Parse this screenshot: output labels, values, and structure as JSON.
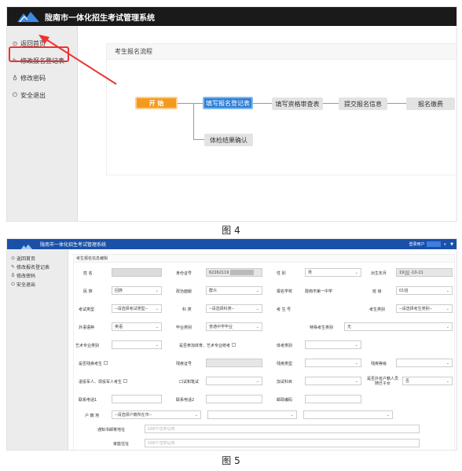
{
  "app": {
    "title": "陇南市一体化招生考试管理系统"
  },
  "fig4": {
    "sidebar": [
      {
        "icon": "⊙",
        "label": "返回首页"
      },
      {
        "icon": "✎",
        "label": "修改报名登记表"
      },
      {
        "icon": "♁",
        "label": "修改密码"
      },
      {
        "icon": "⏻",
        "label": "安全退出"
      }
    ],
    "panel_title": "考生报名流程",
    "flow": {
      "start": "开 始",
      "step1": "填写报名登记表",
      "step2": "填写资格审查表",
      "step3": "提交报名信息",
      "step4": "报名缴费",
      "step5": "体检结果确认"
    },
    "caption": "图 4"
  },
  "fig5": {
    "user_label": "登录用户",
    "user_caret": "∨",
    "sidebar": [
      {
        "icon": "⊙",
        "label": "返回首页"
      },
      {
        "icon": "✎",
        "label": "修改报名登记表"
      },
      {
        "icon": "♁",
        "label": "修改密码"
      },
      {
        "icon": "⏻",
        "label": "安全退出"
      }
    ],
    "form_title": "考生报名信息编辑",
    "labels": {
      "name": "姓 名",
      "id_no": "身份证号",
      "gender": "性 别",
      "birth": "出生年月",
      "ethnic": "民 族",
      "politics": "政治面貌",
      "school": "报名学校",
      "class": "班 级",
      "exam_type": "考试类型",
      "subject": "科 类",
      "exam_no": "考 生 号",
      "exam_category": "考生类别",
      "foreign_lang": "外语语种",
      "grad_type": "毕业类别",
      "special_type": "特殊考生类别",
      "art_pro": "艺术专业类别",
      "art_check": "是否参加体育、艺术专业统考",
      "sport_type": "体考类别",
      "scholar_exam": "是否残疾考生",
      "disab_cert": "残疾证号",
      "disab_grade": "残疾等级",
      "retire_soldier": "退役军人、现役军人考生",
      "oral": "口试和笔试",
      "add_subject": "加试科目",
      "outside_prov": "是否外省户籍人员随迁子女",
      "phone1": "联系电话1",
      "phone2": "联系电话2",
      "postcode": "邮政编码",
      "hukou": "户 籍 地",
      "mail_addr": "通知书邮寄地址",
      "home_addr": "家庭住址"
    },
    "values": {
      "id_no": "62262119",
      "gender": "男",
      "birth": "19",
      "birth_tail": "-10-21",
      "ethnic": "回族",
      "politics": "群众",
      "school": "陇南市第一中学",
      "class": "01班",
      "exam_type": "--请选择考试类型--",
      "subject": "--请选择科类--",
      "exam_category": "--请选择考生类别--",
      "foreign_lang": "英语",
      "grad_type": "普通中学毕业",
      "special_type": "无",
      "outside_prov": "否",
      "hukou": "--请选择户籍所在市--",
      "mail_addr_ph": "100个汉字以内",
      "home_addr_ph": "100个汉字以内"
    },
    "caption": "图 5"
  }
}
